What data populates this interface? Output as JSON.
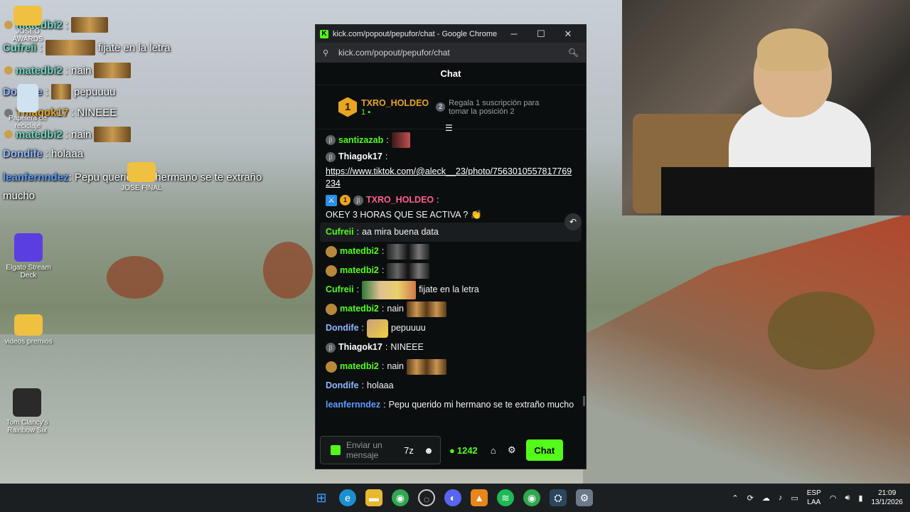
{
  "overlay": {
    "lines": [
      {
        "user": "matedbi2",
        "text": "",
        "emote": true,
        "color": "#6fd6c0"
      },
      {
        "user": "Cufreii",
        "text": "fijate en la letra",
        "emote": true,
        "color": "#6fd6c0"
      },
      {
        "user": "matedbi2",
        "text": "nain",
        "emote": true,
        "color": "#6fd6c0"
      },
      {
        "user": "Dondife",
        "text": "pepuuuu",
        "emote": true,
        "color": "#8fb7ff"
      },
      {
        "user": "Thiagok17",
        "text": "NINEEE",
        "emote": false,
        "color": "#e8a521"
      },
      {
        "user": "matedbi2",
        "text": "nain",
        "emote": true,
        "color": "#6fd6c0"
      },
      {
        "user": "Dondife",
        "text": "holaaa",
        "emote": false,
        "color": "#8fb7ff"
      },
      {
        "user": "leanfernndez",
        "text": "Pepu querido mi hermano se te extraño mucho",
        "emote": false,
        "color": "#5b9bff"
      }
    ]
  },
  "desktop": {
    "icons": [
      {
        "label": "JOSEO AWARDS"
      },
      {
        "label": "Papelera de reciclaje"
      },
      {
        "label": "JOSE FINAL"
      },
      {
        "label": "Elgato Stream Deck"
      },
      {
        "label": "videos premios"
      },
      {
        "label": "Tom Clancy's Rainbow Six"
      }
    ]
  },
  "browser": {
    "title": "kick.com/popout/pepufor/chat - Google Chrome",
    "favicon": "K",
    "url": "kick.com/popout/pepufor/chat",
    "controls": {
      "minimize": "─",
      "maximize": "☐",
      "close": "✕"
    }
  },
  "chat": {
    "header": "Chat",
    "leaderboard": {
      "rank": "1",
      "user": "TXRO_HOLDEO",
      "count": "1",
      "hint_num": "2",
      "hint": "Regala 1 suscripción para tomar la posición 2"
    },
    "messages": [
      {
        "user": "santizazab",
        "user_color": "#53fc18",
        "text": "",
        "badge": "grey",
        "emote": "small"
      },
      {
        "user": "Thiagok17",
        "user_color": "#ffffff",
        "text": "",
        "badge": "grey",
        "link": "https://www.tiktok.com/@aleck__23/photo/7563010557817769234"
      },
      {
        "user": "TXRO_HOLDEO",
        "user_color": "#ff5f8f",
        "text": "OKEY 3 HORAS QUE SE ACTIVA ?",
        "badge": "txro"
      },
      {
        "user": "Cufreii",
        "user_color": "#53fc18",
        "text": "aa mira buena data",
        "badge": "none",
        "highlight": true
      },
      {
        "user": "matedbi2",
        "user_color": "#53fc18",
        "text": "",
        "badge": "gold",
        "emote": "dark"
      },
      {
        "user": "matedbi2",
        "user_color": "#53fc18",
        "text": "",
        "badge": "gold",
        "emote": "dark"
      },
      {
        "user": "Cufreii",
        "user_color": "#53fc18",
        "text": "fijate en la letra",
        "badge": "none",
        "emote": "face"
      },
      {
        "user": "matedbi2",
        "user_color": "#53fc18",
        "text": "nain",
        "badge": "gold",
        "emote": "gold"
      },
      {
        "user": "Dondife",
        "user_color": "#8fb7ff",
        "text": "pepuuuu",
        "badge": "none",
        "emote": "cat"
      },
      {
        "user": "Thiagok17",
        "user_color": "#ffffff",
        "text": "NINEEE",
        "badge": "grey"
      },
      {
        "user": "matedbi2",
        "user_color": "#53fc18",
        "text": "nain",
        "badge": "gold",
        "emote": "gold"
      },
      {
        "user": "Dondife",
        "user_color": "#8fb7ff",
        "text": "holaaa",
        "badge": "none"
      },
      {
        "user": "leanfernndez",
        "user_color": "#5b9bff",
        "text": "Pepu querido mi hermano se te extraño mucho",
        "badge": "none"
      }
    ],
    "composer": {
      "placeholder": "Enviar un mensaje",
      "points": "1242",
      "send_label": "Chat"
    }
  },
  "taskbar": {
    "apps": [
      {
        "name": "windows-start",
        "glyph": "⊞",
        "color": "#3aa0ff"
      },
      {
        "name": "edge",
        "glyph": "e",
        "color": "#1a8fd0"
      },
      {
        "name": "file-explorer",
        "glyph": "▬",
        "color": "#e8b830"
      },
      {
        "name": "chrome",
        "glyph": "◉",
        "color": "#2fa84f"
      },
      {
        "name": "app-circle",
        "glyph": "◌",
        "color": "#555"
      },
      {
        "name": "discord",
        "glyph": "◐",
        "color": "#5865f2"
      },
      {
        "name": "fl-studio",
        "glyph": "▲",
        "color": "#e8861a"
      },
      {
        "name": "spotify",
        "glyph": "≋",
        "color": "#1db954"
      },
      {
        "name": "chrome-2",
        "glyph": "◉",
        "color": "#2fa84f"
      },
      {
        "name": "steam",
        "glyph": "⛭",
        "color": "#1b2838"
      },
      {
        "name": "settings",
        "glyph": "⚙",
        "color": "#6a7a8a"
      }
    ],
    "lang_line1": "ESP",
    "lang_line2": "LAA",
    "time": "21:09",
    "date": "13/1/2026"
  }
}
